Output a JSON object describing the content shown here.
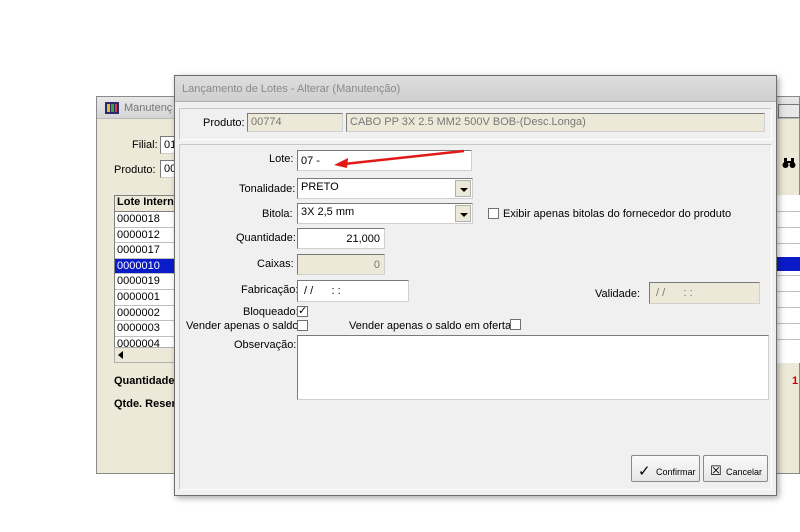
{
  "background_window": {
    "title": "Manutenç",
    "filial_label": "Filial:",
    "filial_value": "01",
    "produto_label": "Produto:",
    "produto_value": "00",
    "grid_header": "Lote Intern",
    "grid_rows": [
      "0000018",
      "0000012",
      "0000017",
      "0000010",
      "0000019",
      "0000001",
      "0000002",
      "0000003",
      "0000004"
    ],
    "selected_row": 3,
    "quantidade_label": "Quantidade T",
    "qtde_reserva_label": "Qtde. Reserv",
    "right_value": "1",
    "binoculars_icon": "binoculars-icon"
  },
  "dialog": {
    "title": "Lançamento de Lotes - Alterar (Manutenção)",
    "produto_label": "Produto:",
    "produto_code": "00774",
    "produto_desc": "CABO PP 3X 2.5 MM2 500V BOB-(Desc.Longa)",
    "lote_label": "Lote:",
    "lote_value": "07 -",
    "tonalidade_label": "Tonalidade:",
    "tonalidade_value": "PRETO",
    "bitola_label": "Bitola:",
    "bitola_value": "3X 2,5 mm",
    "exibir_bitolas_label": "Exibir apenas bitolas do fornecedor do produto",
    "exibir_bitolas_checked": false,
    "quantidade_label": "Quantidade:",
    "quantidade_value": "21,000",
    "caixas_label": "Caixas:",
    "caixas_value": "0",
    "fabricacao_label": "Fabricação:",
    "fabricacao_value": " / /      : :",
    "validade_label": "Validade:",
    "validade_value": " / /      : :",
    "bloqueado_label": "Bloqueado:",
    "bloqueado_checked": true,
    "vender_saldo_label": "Vender apenas o saldo:",
    "vender_saldo_checked": false,
    "vender_oferta_label": "Vender apenas o saldo em oferta",
    "vender_oferta_checked": false,
    "observacao_label": "Observação:",
    "observacao_value": "",
    "confirmar_label": "Confirmar",
    "cancelar_label": "Cancelar"
  },
  "annotation": {
    "arrow_color": "#e11919"
  },
  "colors": {
    "selection": "#0a1cc8",
    "right_value": "#cc0000"
  }
}
